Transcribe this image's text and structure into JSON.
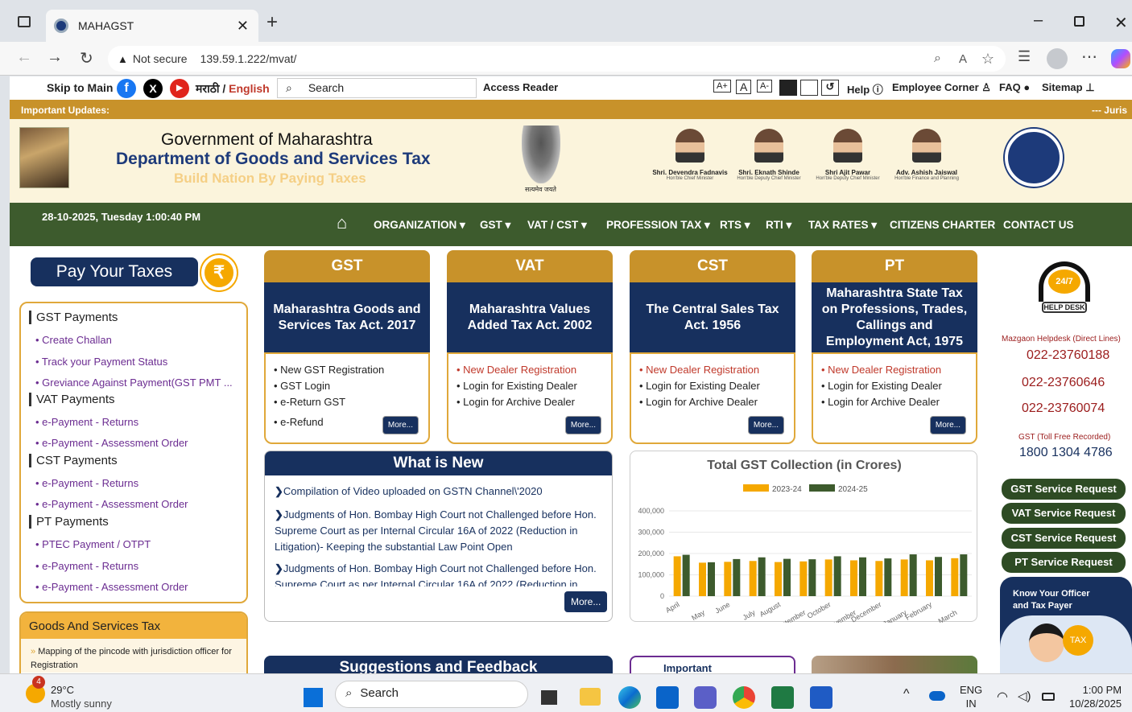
{
  "browser": {
    "tab_title": "MAHAGST",
    "not_secure": "Not secure",
    "url": "139.59.1.222/mvat/"
  },
  "topbar": {
    "skip": "Skip to Main",
    "marathi": "मराठी",
    "slash": " / ",
    "english": "English",
    "search_placeholder": "Search",
    "access_reader": "Access Reader",
    "font_a_plus": "A+",
    "font_a": "A",
    "font_a_minus": "A-",
    "help": "Help",
    "employee": "Employee Corner",
    "faq": "FAQ",
    "sitemap": "Sitemap"
  },
  "updates": {
    "label": "Important Updates:",
    "ticker": "--- Juris"
  },
  "header": {
    "line1": "Government of Maharashtra",
    "line2": "Department of Goods and Services Tax",
    "tagline": "Build Nation By Paying Taxes",
    "emblem_caption": "सत्यमेव जयते",
    "officials": [
      {
        "name": "Shri. Devendra Fadnavis",
        "role": "Hon'ble Chief Minister"
      },
      {
        "name": "Shri. Eknath Shinde",
        "role": "Hon'ble Deputy Chief Minister"
      },
      {
        "name": "Shri Ajit Pawar",
        "role": "Hon'ble Deputy Chief Minister"
      },
      {
        "name": "Adv. Ashish Jaiswal",
        "role": "Hon'ble Finance and Planning"
      }
    ]
  },
  "nav": {
    "datetime": "28-10-2025, Tuesday 1:00:40 PM",
    "items": [
      "ORGANIZATION ▾",
      "GST ▾",
      "VAT / CST ▾",
      "PROFESSION TAX ▾",
      "RTS ▾",
      "RTI ▾",
      "TAX RATES ▾",
      "CITIZENS CHARTER",
      "CONTACT US"
    ]
  },
  "left": {
    "pay": "Pay Your Taxes",
    "gst_head": "GST Payments",
    "gst_links": [
      "• Create Challan",
      "• Track your Payment Status",
      "• Greviance Against Payment(GST PMT ..."
    ],
    "vat_head": "VAT Payments",
    "vat_links": [
      "• e-Payment - Returns",
      "• e-Payment - Assessment Order"
    ],
    "cst_head": "CST Payments",
    "cst_links": [
      "• e-Payment - Returns",
      "• e-Payment - Assessment Order"
    ],
    "pt_head": "PT Payments",
    "pt_links": [
      "• PTEC Payment / OTPT",
      "• e-Payment - Returns",
      "• e-Payment - Assessment Order"
    ],
    "gst_box_title": "Goods And Services Tax",
    "gst_box_item": "Mapping of the pincode with jurisdiction officer for Registration"
  },
  "cards": [
    {
      "head": "GST",
      "body": "Maharashtra Goods and Services Tax Act. 2017",
      "links": [
        "• New GST Registration",
        "• GST Login",
        "• e-Return GST",
        "• e-Refund"
      ],
      "more": "More..."
    },
    {
      "head": "VAT",
      "body": "Maharashtra Values Added Tax Act. 2002",
      "links": [
        "• New Dealer Registration",
        "• Login for Existing Dealer",
        "• Login for Archive Dealer"
      ],
      "more": "More..."
    },
    {
      "head": "CST",
      "body": "The Central Sales Tax Act. 1956",
      "links": [
        "• New Dealer Registration",
        "• Login for Existing Dealer",
        "• Login for Archive Dealer"
      ],
      "more": "More..."
    },
    {
      "head": "PT",
      "body": "Maharashtra State Tax on Professions, Trades, Callings and Employment Act, 1975",
      "links": [
        "• New Dealer Registration",
        "• Login for Existing Dealer",
        "• Login for Archive Dealer"
      ],
      "more": "More..."
    }
  ],
  "whatsnew": {
    "title": "What is New",
    "items": [
      "Compilation of Video uploaded on GSTN Channel\\'2020",
      "Judgments of Hon. Bombay High Court not Challenged before Hon. Supreme Court as per Internal Circular 16A of 2022 (Reduction in Litigation)- Keeping the substantial Law Point Open",
      "Judgments of Hon. Bombay High Court not Challenged before Hon. Supreme Court as per Internal Circular 16A of 2022 (Reduction in"
    ],
    "more": "More..."
  },
  "chart_data": {
    "type": "bar",
    "title": "Total GST Collection (in Crores)",
    "categories": [
      "April",
      "May",
      "June",
      "July",
      "August",
      "September",
      "October",
      "November",
      "December",
      "January",
      "February",
      "March"
    ],
    "series": [
      {
        "name": "2023-24",
        "color": "#f5a800",
        "values": [
          187000,
          157000,
          161000,
          165000,
          160000,
          163000,
          172000,
          168000,
          165000,
          172000,
          168000,
          178000
        ]
      },
      {
        "name": "2024-25",
        "color": "#3d5b2d",
        "values": [
          194000,
          159000,
          174000,
          182000,
          175000,
          173000,
          187000,
          182000,
          177000,
          196000,
          184000,
          196000
        ]
      }
    ],
    "ylim": [
      0,
      400000
    ],
    "yticks": [
      "0",
      "100,000",
      "200,000",
      "300,000",
      "400,000"
    ]
  },
  "right": {
    "helpdesk_24": "24/7",
    "helpdesk_label": "HELP DESK",
    "mazgaon": "Mazgaon Helpdesk (Direct Lines)",
    "phones": [
      "022-23760188",
      "022-23760646",
      "022-23760074"
    ],
    "toll_label": "GST (Toll Free Recorded)",
    "toll": "1800 1304 4786",
    "services": [
      "GST Service Request",
      "VAT Service Request",
      "CST Service Request",
      "PT Service Request"
    ],
    "know": "Know Your Officer and Tax Payer",
    "tax_badge": "TAX"
  },
  "bottom": {
    "suggest": "Suggestions and Feedback",
    "important": "Important"
  },
  "taskbar": {
    "temp": "29°C",
    "weather": "Mostly sunny",
    "badge": "4",
    "search": "Search",
    "lang1": "ENG",
    "lang2": "IN",
    "time": "1:00 PM",
    "date": "10/28/2025"
  }
}
